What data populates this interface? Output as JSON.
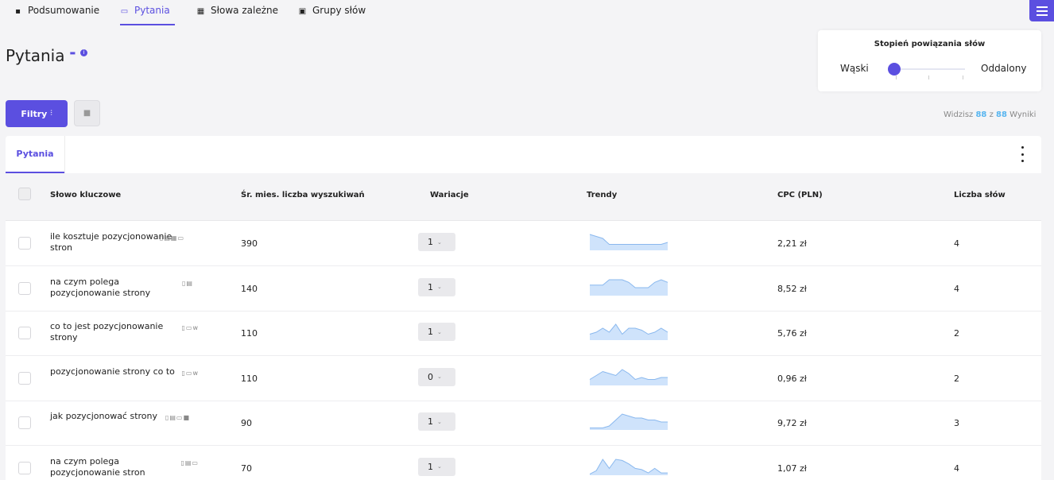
{
  "nav": {
    "tabs": [
      {
        "label": "Podsumowanie",
        "icon": "dashboard-icon"
      },
      {
        "label": "Pytania",
        "icon": "question-icon"
      },
      {
        "label": "Słowa zależne",
        "icon": "related-words-icon"
      },
      {
        "label": "Grupy słów",
        "icon": "word-groups-icon"
      }
    ],
    "active": "Pytania"
  },
  "page": {
    "title": "Pytania"
  },
  "slider": {
    "title": "Stopień powiązania słów",
    "left_label": "Wąski",
    "right_label": "Oddalony",
    "value": 0
  },
  "toolbar": {
    "filter_label": "Filtry"
  },
  "results": {
    "prefix": "Widzisz",
    "shown": "88",
    "sep": "z",
    "total": "88",
    "suffix": "Wyniki"
  },
  "panel": {
    "tab_label": "Pytania"
  },
  "table": {
    "columns": [
      "Słowo kluczowe",
      "Śr. mies. liczba wyszukiwań",
      "Wariacje",
      "Trendy",
      "CPC (PLN)",
      "Liczba słów"
    ],
    "rows": [
      {
        "keyword": "ile kosztuje pozycjonowanie stron",
        "serp": "▯▤▦▭",
        "volume": "390",
        "variations": "1",
        "cpc": "2,21 zł",
        "words": "4",
        "trend": [
          8,
          7,
          6,
          3,
          3,
          3,
          3,
          3,
          3,
          3,
          3,
          3,
          4
        ]
      },
      {
        "keyword": "na czym polega pozycjonowanie strony",
        "serp": "▯▤",
        "volume": "140",
        "variations": "1",
        "cpc": "8,52 zł",
        "words": "4",
        "trend": [
          4,
          4,
          4,
          6,
          6,
          6,
          5,
          3,
          3,
          3,
          5,
          6,
          5
        ]
      },
      {
        "keyword": "co to jest pozycjonowanie strony",
        "serp": "▯▭w",
        "volume": "110",
        "variations": "1",
        "cpc": "5,76 zł",
        "words": "2",
        "trend": [
          3,
          4,
          6,
          4,
          8,
          3,
          6,
          6,
          5,
          3,
          4,
          6,
          4
        ]
      },
      {
        "keyword": "pozycjonowanie strony co to",
        "serp": "▯▭w",
        "volume": "110",
        "variations": "0",
        "cpc": "0,96 zł",
        "words": "2",
        "trend": [
          3,
          5,
          7,
          6,
          5,
          8,
          6,
          3,
          4,
          3,
          3,
          4,
          4
        ]
      },
      {
        "keyword": "jak pozycjonować strony",
        "serp": "▯▤▭■",
        "volume": "90",
        "variations": "1",
        "cpc": "9,72 zł",
        "words": "3",
        "trend": [
          1,
          1,
          1,
          2,
          5,
          8,
          7,
          6,
          6,
          5,
          5,
          4,
          4
        ]
      },
      {
        "keyword": "na czym polega pozycjonowanie stron",
        "serp": "▯▤▭",
        "volume": "70",
        "variations": "1",
        "cpc": "1,07 zł",
        "words": "4",
        "trend": [
          1,
          4,
          14,
          6,
          14,
          13,
          10,
          6,
          5,
          2,
          6,
          2,
          2
        ]
      }
    ]
  },
  "colors": {
    "accent": "#5b4fe0",
    "link": "#57b5f0",
    "trend_fill": "#cfe3fb",
    "trend_line": "#8ab8ee"
  }
}
